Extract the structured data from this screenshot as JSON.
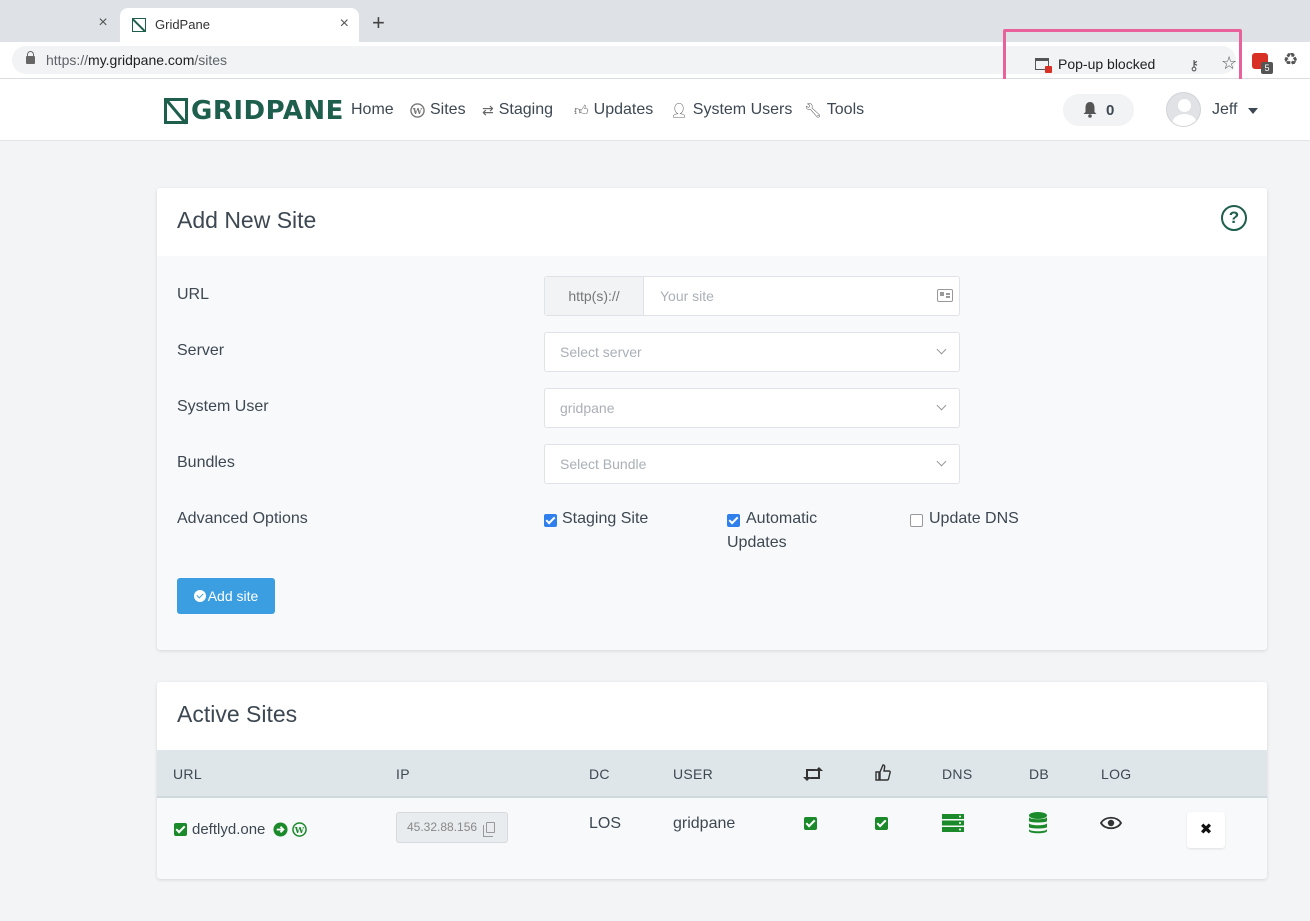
{
  "browser": {
    "tab_title": "GridPane",
    "url_scheme": "https://",
    "url_domain": "my.gridpane.com",
    "url_path": "/sites",
    "popup_text": "Pop-up blocked",
    "extension_badge": "5"
  },
  "nav": {
    "logo": "GRIDPANE",
    "items": [
      "Home",
      "Sites",
      "Staging",
      "Updates",
      "System Users",
      "Tools"
    ],
    "notif_count": "0",
    "user": "Jeff"
  },
  "add_site": {
    "title": "Add New Site",
    "url_label": "URL",
    "url_prefix": "http(s)://",
    "url_placeholder": "Your site",
    "server_label": "Server",
    "server_value": "Select server",
    "sysuser_label": "System User",
    "sysuser_value": "gridpane",
    "bundles_label": "Bundles",
    "bundles_value": "Select Bundle",
    "advanced_label": "Advanced Options",
    "opt_staging": "Staging Site",
    "opt_updates_1": "Automatic",
    "opt_updates_2": "Updates",
    "opt_dns": "Update DNS",
    "button": "Add site"
  },
  "active_sites": {
    "title": "Active Sites",
    "headers": {
      "url": "URL",
      "ip": "IP",
      "dc": "DC",
      "user": "USER",
      "dns": "DNS",
      "db": "DB",
      "log": "LOG"
    },
    "rows": [
      {
        "url": "deftlyd.one",
        "ip": "45.32.88.156",
        "dc": "LOS",
        "user": "gridpane"
      }
    ]
  },
  "colors": {
    "brand": "#1e5e4c",
    "accent": "#3b9ee0",
    "ok": "#1b8a2a",
    "highlight": "#e8619a"
  }
}
